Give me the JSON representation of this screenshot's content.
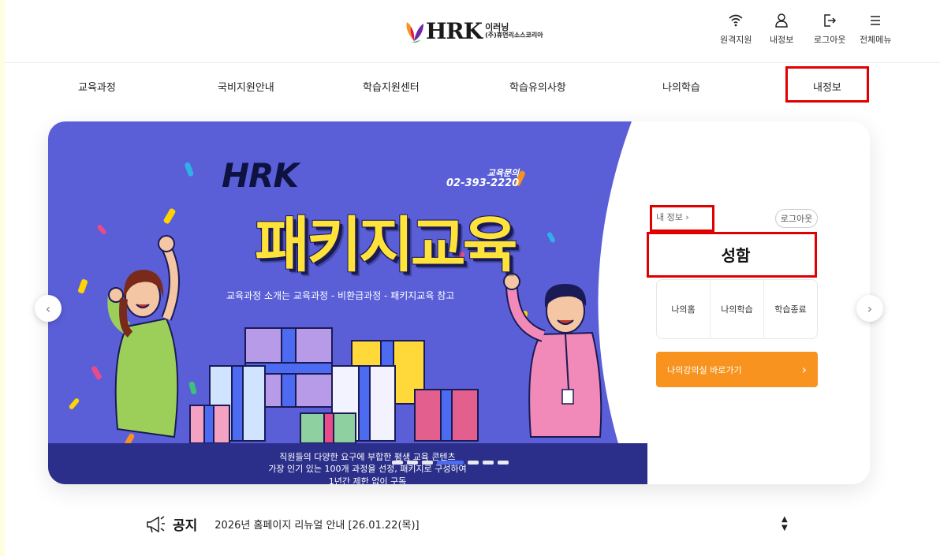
{
  "header": {
    "logo": {
      "brand": "HRK",
      "sub_line1": "이러닝",
      "sub_line2": "(주)휴먼리소스코리아"
    },
    "utilities": [
      {
        "icon": "wifi-icon",
        "label": "원격지원"
      },
      {
        "icon": "user-icon",
        "label": "내정보"
      },
      {
        "icon": "logout-icon",
        "label": "로그아웃"
      },
      {
        "icon": "menu-icon",
        "label": "전체메뉴"
      }
    ]
  },
  "nav": {
    "items": [
      "교육과정",
      "국비지원안내",
      "학습지원센터",
      "학습유의사항",
      "나의학습",
      "내정보"
    ]
  },
  "banner": {
    "hrk": "HRK",
    "inquiry_label": "교육문의",
    "inquiry_phone": "02-393-2220",
    "title": "패키지교육",
    "subtitle": "교육과정 소개는 교육과정 - 비환급과정 - 패키지교육 참고",
    "bottom_line1": "직원들의 다양한 요구에 부합한 평생 교육 콘텐츠",
    "bottom_line2": "가장 인기 있는 100개 과정을 선정, 패키지로 구성하여",
    "bottom_line3": "1년간 제한 없이 구독",
    "slide_count": 7,
    "active_slide": 3,
    "colors": {
      "bg": "#5a5fd8",
      "band": "#2b2f8a",
      "title": "#ffe23a"
    }
  },
  "panel": {
    "mypage_link": "내 정보 ›",
    "logout": "로그아웃",
    "name": "성함",
    "quick_links": [
      "나의홈",
      "나의학습",
      "학습종료"
    ],
    "classroom_button": "나의강의실 바로가기",
    "classroom_arrow": "›",
    "accent": "#f7931e"
  },
  "carousel": {
    "prev": "‹",
    "next": "›"
  },
  "notice": {
    "label": "공지",
    "text": "2026년 홈페이지 리뉴얼 안내 [26.01.22(목)]",
    "up": "▲",
    "down": "▼"
  }
}
